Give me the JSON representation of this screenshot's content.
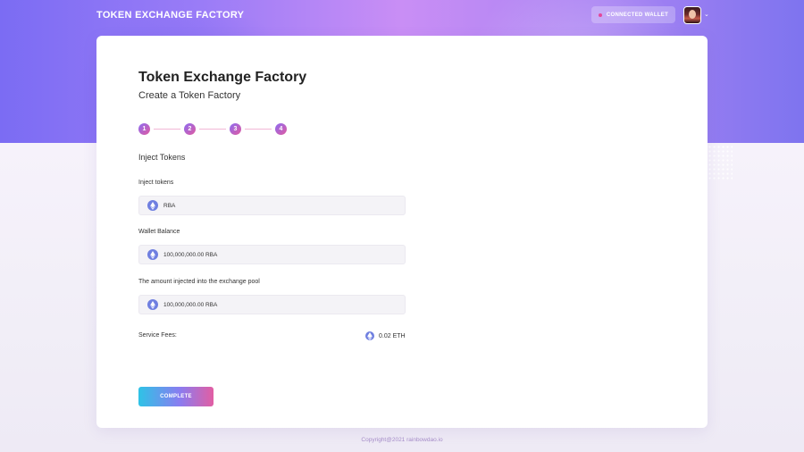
{
  "header": {
    "brand": "TOKEN EXCHANGE FACTORY",
    "wallet_button": "CONNECTED  WALLET",
    "avatar": "avatar"
  },
  "card": {
    "title": "Token Exchange Factory",
    "subtitle": "Create a Token Factory",
    "steps": [
      "1",
      "2",
      "3",
      "4"
    ],
    "section_title": "Inject Tokens",
    "fields": [
      {
        "label": "Inject tokens",
        "value": "RBA"
      },
      {
        "label": "Wallet Balance",
        "value": "100,000,000.00 RBA"
      },
      {
        "label": "The amount injected into the exchange pool",
        "value": "100,000,000.00 RBA"
      }
    ],
    "fees": {
      "label": "Service Fees:",
      "value": "0.02 ETH"
    },
    "complete_button": "COMPLETE"
  },
  "footer": {
    "copyright": "Copyright@2021 rainbowdao.io"
  },
  "colors": {
    "accent_pink": "#e05aa0",
    "accent_purple": "#8c6cf2",
    "accent_cyan": "#2ec3e6",
    "eth_icon": "#6f7fe0"
  }
}
